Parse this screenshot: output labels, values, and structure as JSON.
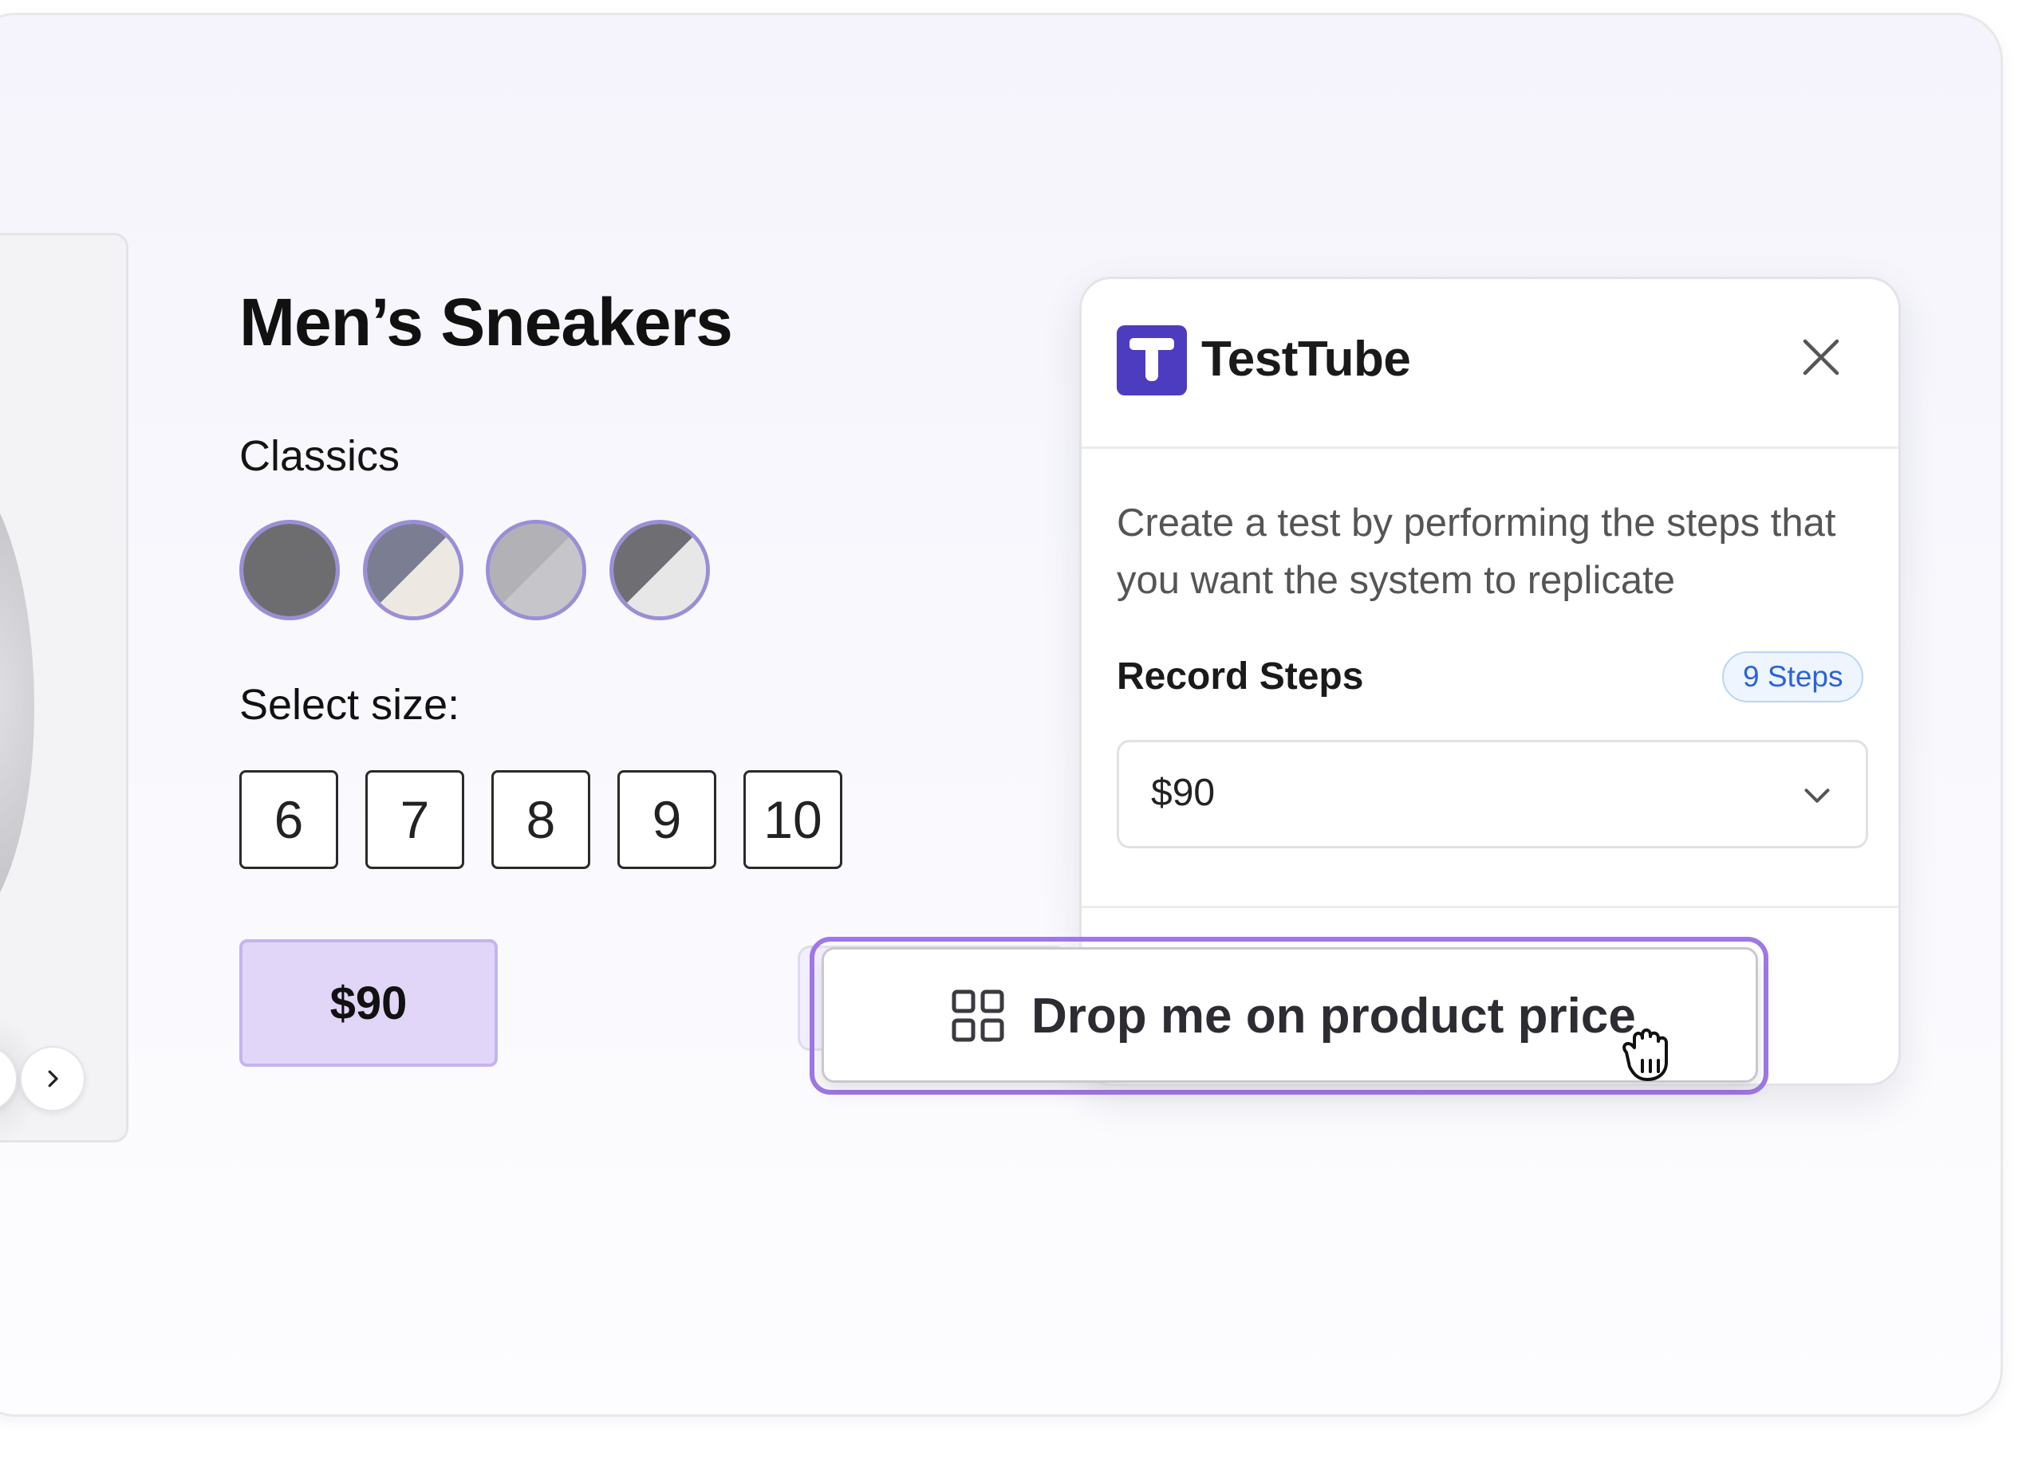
{
  "product": {
    "title": "Men’s Sneakers",
    "collection": "Classics",
    "swatches": [
      {
        "name": "dark-grey",
        "colors": [
          "#6d6d70"
        ]
      },
      {
        "name": "slate-cream",
        "colors": [
          "#7b7d92",
          "#ede9e2"
        ]
      },
      {
        "name": "light-grey",
        "colors": [
          "#b2b1b6",
          "#c6c5ca"
        ]
      },
      {
        "name": "charcoal-white",
        "colors": [
          "#6f6e72",
          "#e8e7e7"
        ]
      }
    ],
    "size_label": "Select size:",
    "sizes": [
      "6",
      "7",
      "8",
      "9",
      "10"
    ],
    "price": "$90"
  },
  "panel": {
    "brand": "TestTube",
    "logo_letter": "T",
    "description": "Create a test by performing the steps that you want the system to replicate",
    "record_label": "Record Steps",
    "steps_badge": "9 Steps",
    "select_value": "$90"
  },
  "drag_item": {
    "label": "Drop me on product price",
    "icon": "grid-icon"
  },
  "colors": {
    "accent_purple": "#a077e8",
    "price_bg": "#e1d6f7",
    "logo_bg": "#4d3cc0",
    "badge_text": "#2b63d9",
    "swatch_border": "#9a8fd6"
  }
}
